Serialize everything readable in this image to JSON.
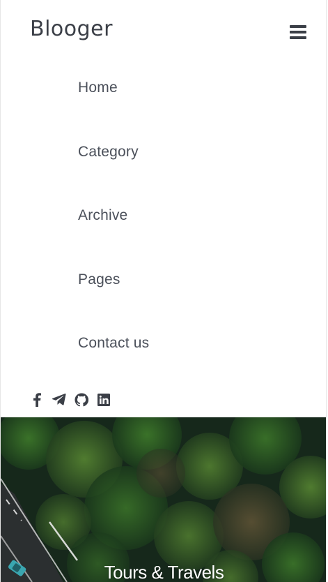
{
  "header": {
    "brand": "Blooger",
    "menu_icon": "hamburger-menu-icon"
  },
  "nav": {
    "items": [
      {
        "label": "Home"
      },
      {
        "label": "Category"
      },
      {
        "label": "Archive"
      },
      {
        "label": "Pages"
      },
      {
        "label": "Contact us"
      }
    ]
  },
  "social": {
    "icons": [
      "facebook-icon",
      "telegram-icon",
      "github-icon",
      "linkedin-icon"
    ]
  },
  "hero": {
    "title": "Tours & Travels"
  },
  "colors": {
    "text": "#3b3f47",
    "nav_text": "#4b505a",
    "hero_bg": "#13241a",
    "hero_title": "#ffffff"
  }
}
